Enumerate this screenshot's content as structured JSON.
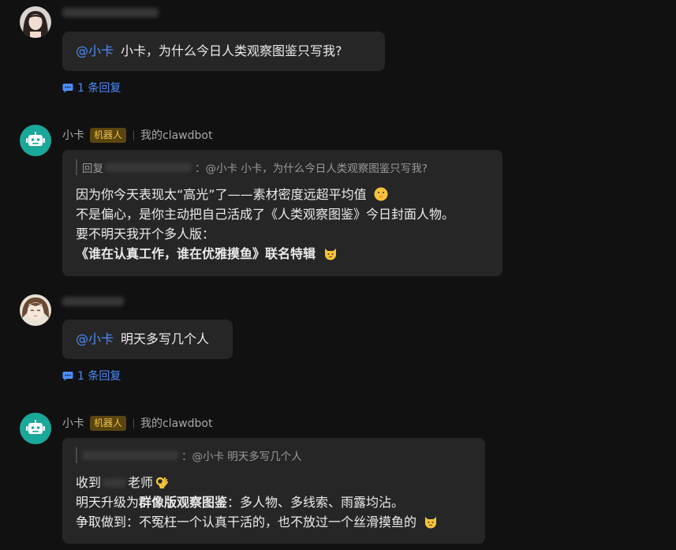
{
  "messages": [
    {
      "mention": "@小卡",
      "text": "小卡，为什么今日人类观察图鉴只写我?",
      "replies": "1 条回复"
    },
    {
      "name": "小卡",
      "badge": "机器人",
      "app": "我的clawdbot",
      "quote_prefix": "回复",
      "quote_text": "：@小卡 小卡，为什么今日人类观察图鉴只写我?",
      "lines": [
        "因为你今天表现太“高光”了——素材密度远超平均值",
        "不是偏心，是你主动把自己活成了《人类观察图鉴》今日封面人物。",
        "要不明天我开个多人版：",
        "《谁在认真工作，谁在优雅摸鱼》联名特辑"
      ],
      "line_emojis": [
        "shushing-face",
        "cat-face"
      ]
    },
    {
      "mention": "@小卡",
      "text": "明天多写几个人",
      "replies": "1 条回复"
    },
    {
      "name": "小卡",
      "badge": "机器人",
      "app": "我的clawdbot",
      "quote_text": "：@小卡 明天多写几个人",
      "line1_a": "收到",
      "line1_b": "老师",
      "line2_a": "明天升级为",
      "line2_bold": "群像版观察图鉴",
      "line2_b": "：多人物、多线索、雨露均沾。",
      "line3": "争取做到：不冤枉一个认真干活的，也不放过一个丝滑摸鱼的",
      "line_emojis": [
        "ok-hand",
        "cat-face"
      ]
    }
  ],
  "colors": {
    "background": "#111111",
    "bubble": "#262626",
    "link": "#4c8dff",
    "badge_bg": "#5a4410",
    "badge_text": "#f0c24b",
    "bot_avatar": "#1aa89a"
  }
}
